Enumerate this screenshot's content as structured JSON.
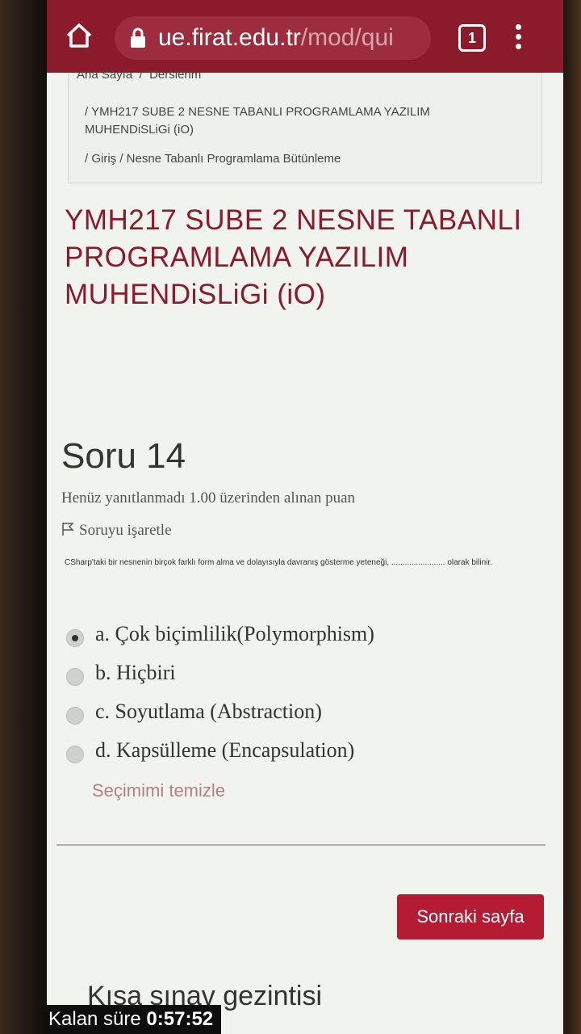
{
  "browser": {
    "url_host": "ue.firat.edu.tr",
    "url_path": "/mod/qui",
    "tab_count": "1"
  },
  "breadcrumb": {
    "home": "Ana Sayfa",
    "sep1": "/",
    "courses": "Derslerim",
    "course": "/  YMH217 SUBE 2 NESNE TABANLI PROGRAMLAMA YAZILIM MUHENDiSLiGi (iO)",
    "path": "/  Giriş  /  Nesne Tabanlı Programlama Bütünleme"
  },
  "course_title": "YMH217 SUBE 2 NESNE TABANLI PROGRAMLAMA YAZILIM MUHENDiSLiGi (iO)",
  "question": {
    "number": "Soru 14",
    "status": "Henüz yanıtlanmadı  1.00 üzerinden alınan puan",
    "flag_label": "Soruyu işaretle",
    "text": "CSharp'taki bir nesnenin birçok farklı form alma ve dolayısıyla davranış gösterme yeteneği, ........................ olarak bilinir.",
    "answers": [
      {
        "label": "a. Çok biçimlilik(Polymorphism)",
        "selected": true
      },
      {
        "label": "b. Hiçbiri",
        "selected": false
      },
      {
        "label": "c. Soyutlama (Abstraction)",
        "selected": false
      },
      {
        "label": "d. Kapsülleme (Encapsulation)",
        "selected": false
      }
    ],
    "clear_label": "Seçimimi temizle"
  },
  "next_button": "Sonraki sayfa",
  "navigation_title": "Kısa sınav gezintisi",
  "timer": {
    "label": "Kalan süre",
    "value": "0:57:52"
  },
  "colors": {
    "brand": "#8b1a2b",
    "button": "#b51c34"
  }
}
